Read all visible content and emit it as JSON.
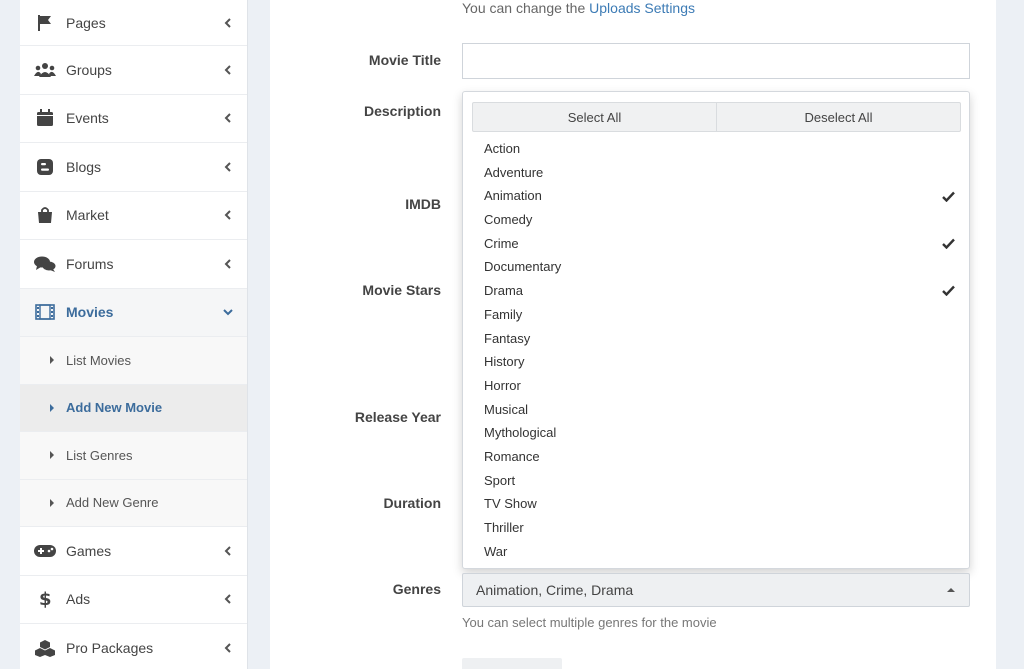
{
  "sidebar": {
    "items": [
      {
        "label": "Pages",
        "icon": "flag-icon"
      },
      {
        "label": "Groups",
        "icon": "users-icon"
      },
      {
        "label": "Events",
        "icon": "calendar-icon"
      },
      {
        "label": "Blogs",
        "icon": "blogger-icon"
      },
      {
        "label": "Market",
        "icon": "shopping-bag-icon"
      },
      {
        "label": "Forums",
        "icon": "comments-icon"
      },
      {
        "label": "Movies",
        "icon": "film-icon"
      }
    ],
    "movies_sub": [
      {
        "label": "List Movies"
      },
      {
        "label": "Add New Movie"
      },
      {
        "label": "List Genres"
      },
      {
        "label": "Add New Genre"
      }
    ],
    "items_after": [
      {
        "label": "Games",
        "icon": "gamepad-icon"
      },
      {
        "label": "Ads",
        "icon": "dollar-icon"
      },
      {
        "label": "Pro Packages",
        "icon": "cubes-icon"
      }
    ]
  },
  "form": {
    "uploads_hint_prefix": "You can change the ",
    "uploads_hint_link": "Uploads Settings",
    "labels": {
      "movie_title": "Movie Title",
      "description": "Description",
      "imdb": "IMDB",
      "movie_stars": "Movie Stars",
      "release_year": "Release Year",
      "duration": "Duration",
      "genres": "Genres"
    },
    "genres_selected": "Animation, Crime, Drama",
    "genres_hint": "You can select multiple genres for the movie"
  },
  "dropdown": {
    "select_all": "Select All",
    "deselect_all": "Deselect All",
    "options": [
      {
        "label": "Action",
        "checked": false
      },
      {
        "label": "Adventure",
        "checked": false
      },
      {
        "label": "Animation",
        "checked": true
      },
      {
        "label": "Comedy",
        "checked": false
      },
      {
        "label": "Crime",
        "checked": true
      },
      {
        "label": "Documentary",
        "checked": false
      },
      {
        "label": "Drama",
        "checked": true
      },
      {
        "label": "Family",
        "checked": false
      },
      {
        "label": "Fantasy",
        "checked": false
      },
      {
        "label": "History",
        "checked": false
      },
      {
        "label": "Horror",
        "checked": false
      },
      {
        "label": "Musical",
        "checked": false
      },
      {
        "label": "Mythological",
        "checked": false
      },
      {
        "label": "Romance",
        "checked": false
      },
      {
        "label": "Sport",
        "checked": false
      },
      {
        "label": "TV Show",
        "checked": false
      },
      {
        "label": "Thriller",
        "checked": false
      },
      {
        "label": "War",
        "checked": false
      }
    ]
  },
  "colors": {
    "accent": "#3c6c9c",
    "link": "#3c7bb5"
  }
}
